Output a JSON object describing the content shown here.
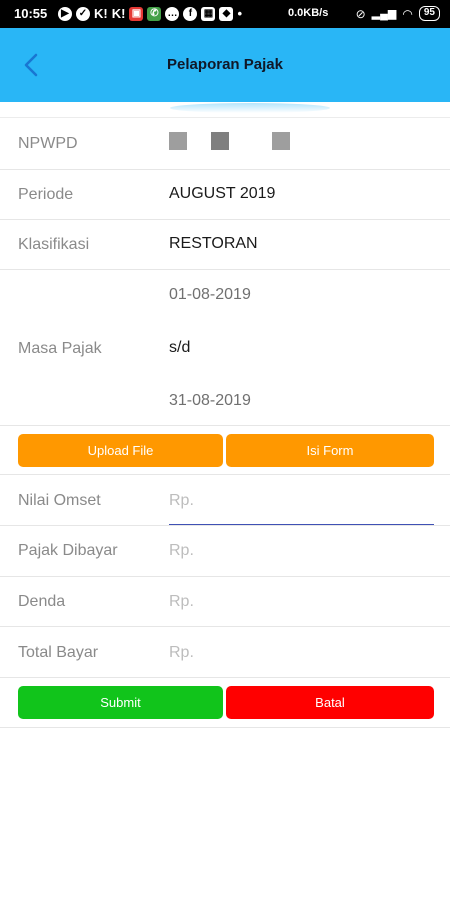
{
  "status_bar": {
    "time": "10:55",
    "speed": "0.0KB/s",
    "battery": "95"
  },
  "app_bar": {
    "title": "Pelaporan Pajak"
  },
  "form": {
    "npwpd_label": "NPWPD",
    "periode_label": "Periode",
    "periode_value": "AUGUST 2019",
    "klasifikasi_label": "Klasifikasi",
    "klasifikasi_value": "RESTORAN",
    "masa_pajak_label": "Masa Pajak",
    "masa_start": "01-08-2019",
    "masa_sep": "s/d",
    "masa_end": "31-08-2019"
  },
  "buttons": {
    "upload": "Upload File",
    "isi_form": "Isi Form",
    "submit": "Submit",
    "batal": "Batal"
  },
  "amounts": {
    "nilai_omset_label": "Nilai Omset",
    "nilai_omset_placeholder": "Rp.",
    "pajak_dibayar_label": "Pajak Dibayar",
    "pajak_dibayar_placeholder": "Rp.",
    "denda_label": "Denda",
    "denda_placeholder": "Rp.",
    "total_bayar_label": "Total Bayar",
    "total_bayar_placeholder": "Rp."
  },
  "colors": {
    "app_bar": "#29b6f6",
    "orange_button": "#ff9800",
    "submit_button": "#11c41b",
    "cancel_button": "#ff0000"
  }
}
